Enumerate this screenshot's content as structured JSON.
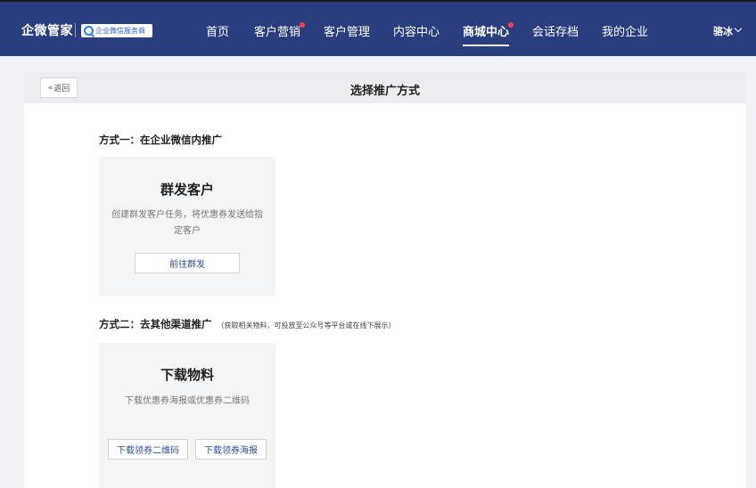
{
  "header": {
    "brand": "企微管家",
    "badge": "企业微信服务商",
    "nav": [
      {
        "label": "首页"
      },
      {
        "label": "客户营销"
      },
      {
        "label": "客户管理"
      },
      {
        "label": "内容中心"
      },
      {
        "label": "商城中心"
      },
      {
        "label": "会话存档"
      },
      {
        "label": "我的企业"
      }
    ],
    "active_nav": "商城中心",
    "user": "骆冰",
    "colors": {
      "bar": "#2a3d7e",
      "dot": "#f5414f"
    }
  },
  "page": {
    "back_label": "返回",
    "title": "选择推广方式"
  },
  "sections": [
    {
      "title": "方式一：在企业微信内推广",
      "note": "",
      "card": {
        "title": "群发客户",
        "desc": "创建群发客户任务，将优惠券发送给指定客户",
        "buttons": [
          "前往群发"
        ]
      }
    },
    {
      "title": "方式二：去其他渠道推广",
      "note": "（获取相关物料，可投放至公众号等平台或在线下展示）",
      "card": {
        "title": "下载物料",
        "desc": "下载优惠券海报或优惠券二维码",
        "buttons": [
          "下载领券二维码",
          "下载领券海报"
        ]
      }
    }
  ]
}
